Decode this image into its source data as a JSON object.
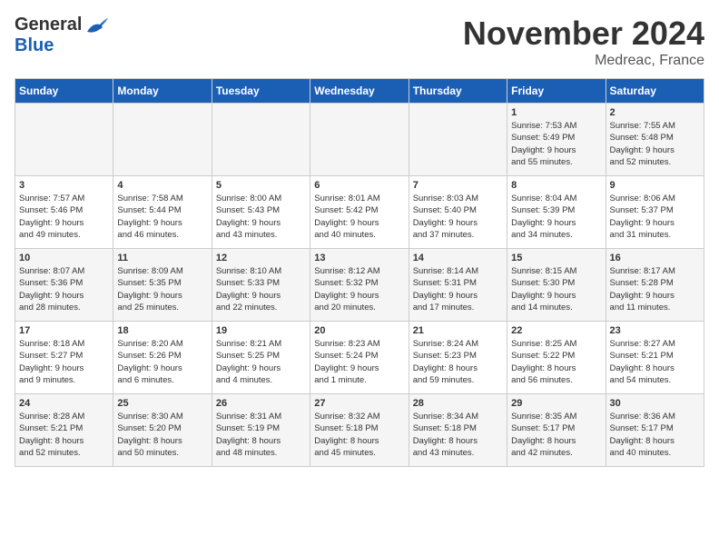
{
  "header": {
    "logo_general": "General",
    "logo_blue": "Blue",
    "month_title": "November 2024",
    "location": "Medreac, France"
  },
  "days_of_week": [
    "Sunday",
    "Monday",
    "Tuesday",
    "Wednesday",
    "Thursday",
    "Friday",
    "Saturday"
  ],
  "weeks": [
    [
      {
        "day": "",
        "info": ""
      },
      {
        "day": "",
        "info": ""
      },
      {
        "day": "",
        "info": ""
      },
      {
        "day": "",
        "info": ""
      },
      {
        "day": "",
        "info": ""
      },
      {
        "day": "1",
        "info": "Sunrise: 7:53 AM\nSunset: 5:49 PM\nDaylight: 9 hours\nand 55 minutes."
      },
      {
        "day": "2",
        "info": "Sunrise: 7:55 AM\nSunset: 5:48 PM\nDaylight: 9 hours\nand 52 minutes."
      }
    ],
    [
      {
        "day": "3",
        "info": "Sunrise: 7:57 AM\nSunset: 5:46 PM\nDaylight: 9 hours\nand 49 minutes."
      },
      {
        "day": "4",
        "info": "Sunrise: 7:58 AM\nSunset: 5:44 PM\nDaylight: 9 hours\nand 46 minutes."
      },
      {
        "day": "5",
        "info": "Sunrise: 8:00 AM\nSunset: 5:43 PM\nDaylight: 9 hours\nand 43 minutes."
      },
      {
        "day": "6",
        "info": "Sunrise: 8:01 AM\nSunset: 5:42 PM\nDaylight: 9 hours\nand 40 minutes."
      },
      {
        "day": "7",
        "info": "Sunrise: 8:03 AM\nSunset: 5:40 PM\nDaylight: 9 hours\nand 37 minutes."
      },
      {
        "day": "8",
        "info": "Sunrise: 8:04 AM\nSunset: 5:39 PM\nDaylight: 9 hours\nand 34 minutes."
      },
      {
        "day": "9",
        "info": "Sunrise: 8:06 AM\nSunset: 5:37 PM\nDaylight: 9 hours\nand 31 minutes."
      }
    ],
    [
      {
        "day": "10",
        "info": "Sunrise: 8:07 AM\nSunset: 5:36 PM\nDaylight: 9 hours\nand 28 minutes."
      },
      {
        "day": "11",
        "info": "Sunrise: 8:09 AM\nSunset: 5:35 PM\nDaylight: 9 hours\nand 25 minutes."
      },
      {
        "day": "12",
        "info": "Sunrise: 8:10 AM\nSunset: 5:33 PM\nDaylight: 9 hours\nand 22 minutes."
      },
      {
        "day": "13",
        "info": "Sunrise: 8:12 AM\nSunset: 5:32 PM\nDaylight: 9 hours\nand 20 minutes."
      },
      {
        "day": "14",
        "info": "Sunrise: 8:14 AM\nSunset: 5:31 PM\nDaylight: 9 hours\nand 17 minutes."
      },
      {
        "day": "15",
        "info": "Sunrise: 8:15 AM\nSunset: 5:30 PM\nDaylight: 9 hours\nand 14 minutes."
      },
      {
        "day": "16",
        "info": "Sunrise: 8:17 AM\nSunset: 5:28 PM\nDaylight: 9 hours\nand 11 minutes."
      }
    ],
    [
      {
        "day": "17",
        "info": "Sunrise: 8:18 AM\nSunset: 5:27 PM\nDaylight: 9 hours\nand 9 minutes."
      },
      {
        "day": "18",
        "info": "Sunrise: 8:20 AM\nSunset: 5:26 PM\nDaylight: 9 hours\nand 6 minutes."
      },
      {
        "day": "19",
        "info": "Sunrise: 8:21 AM\nSunset: 5:25 PM\nDaylight: 9 hours\nand 4 minutes."
      },
      {
        "day": "20",
        "info": "Sunrise: 8:23 AM\nSunset: 5:24 PM\nDaylight: 9 hours\nand 1 minute."
      },
      {
        "day": "21",
        "info": "Sunrise: 8:24 AM\nSunset: 5:23 PM\nDaylight: 8 hours\nand 59 minutes."
      },
      {
        "day": "22",
        "info": "Sunrise: 8:25 AM\nSunset: 5:22 PM\nDaylight: 8 hours\nand 56 minutes."
      },
      {
        "day": "23",
        "info": "Sunrise: 8:27 AM\nSunset: 5:21 PM\nDaylight: 8 hours\nand 54 minutes."
      }
    ],
    [
      {
        "day": "24",
        "info": "Sunrise: 8:28 AM\nSunset: 5:21 PM\nDaylight: 8 hours\nand 52 minutes."
      },
      {
        "day": "25",
        "info": "Sunrise: 8:30 AM\nSunset: 5:20 PM\nDaylight: 8 hours\nand 50 minutes."
      },
      {
        "day": "26",
        "info": "Sunrise: 8:31 AM\nSunset: 5:19 PM\nDaylight: 8 hours\nand 48 minutes."
      },
      {
        "day": "27",
        "info": "Sunrise: 8:32 AM\nSunset: 5:18 PM\nDaylight: 8 hours\nand 45 minutes."
      },
      {
        "day": "28",
        "info": "Sunrise: 8:34 AM\nSunset: 5:18 PM\nDaylight: 8 hours\nand 43 minutes."
      },
      {
        "day": "29",
        "info": "Sunrise: 8:35 AM\nSunset: 5:17 PM\nDaylight: 8 hours\nand 42 minutes."
      },
      {
        "day": "30",
        "info": "Sunrise: 8:36 AM\nSunset: 5:17 PM\nDaylight: 8 hours\nand 40 minutes."
      }
    ]
  ]
}
